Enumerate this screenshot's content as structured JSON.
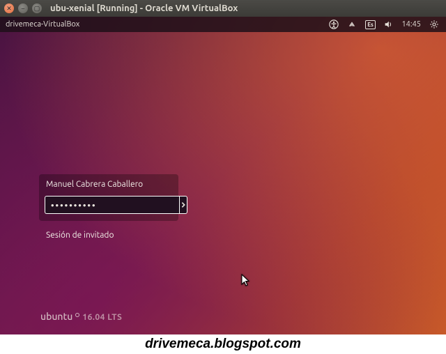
{
  "window": {
    "title": "ubu-xenial [Running] - Oracle VM VirtualBox"
  },
  "menubar": {
    "hostname": "drivemeca-VirtualBox",
    "keyboard_indicator": "Es",
    "time": "14:45"
  },
  "login": {
    "username": "Manuel Cabrera Caballero",
    "password_value": "••••••••••",
    "guest_label": "Sesión de invitado"
  },
  "branding": {
    "distro": "ubuntu",
    "version": "16.04 LTS"
  },
  "watermark": "drivemeca.blogspot.com"
}
